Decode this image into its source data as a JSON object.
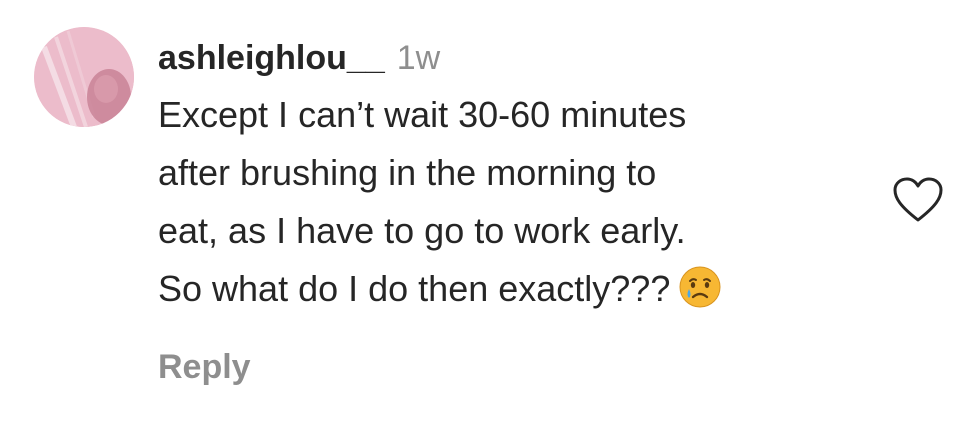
{
  "comment": {
    "username": "ashleighlou__",
    "timestamp": "1w",
    "lines": [
      "Except I can’t wait 30-60 minutes",
      "after brushing in the morning to",
      "eat, as I have to go to work early.",
      "So what do I do then exactly???"
    ],
    "emoji_icon": "crying-face-icon",
    "reply_label": "Reply",
    "like_icon": "heart-outline-icon"
  },
  "colors": {
    "text_primary": "#262626",
    "text_secondary": "#8e8e8e",
    "emoji_yellow": "#f7b733",
    "avatar_pink": "#e6a9b9"
  }
}
